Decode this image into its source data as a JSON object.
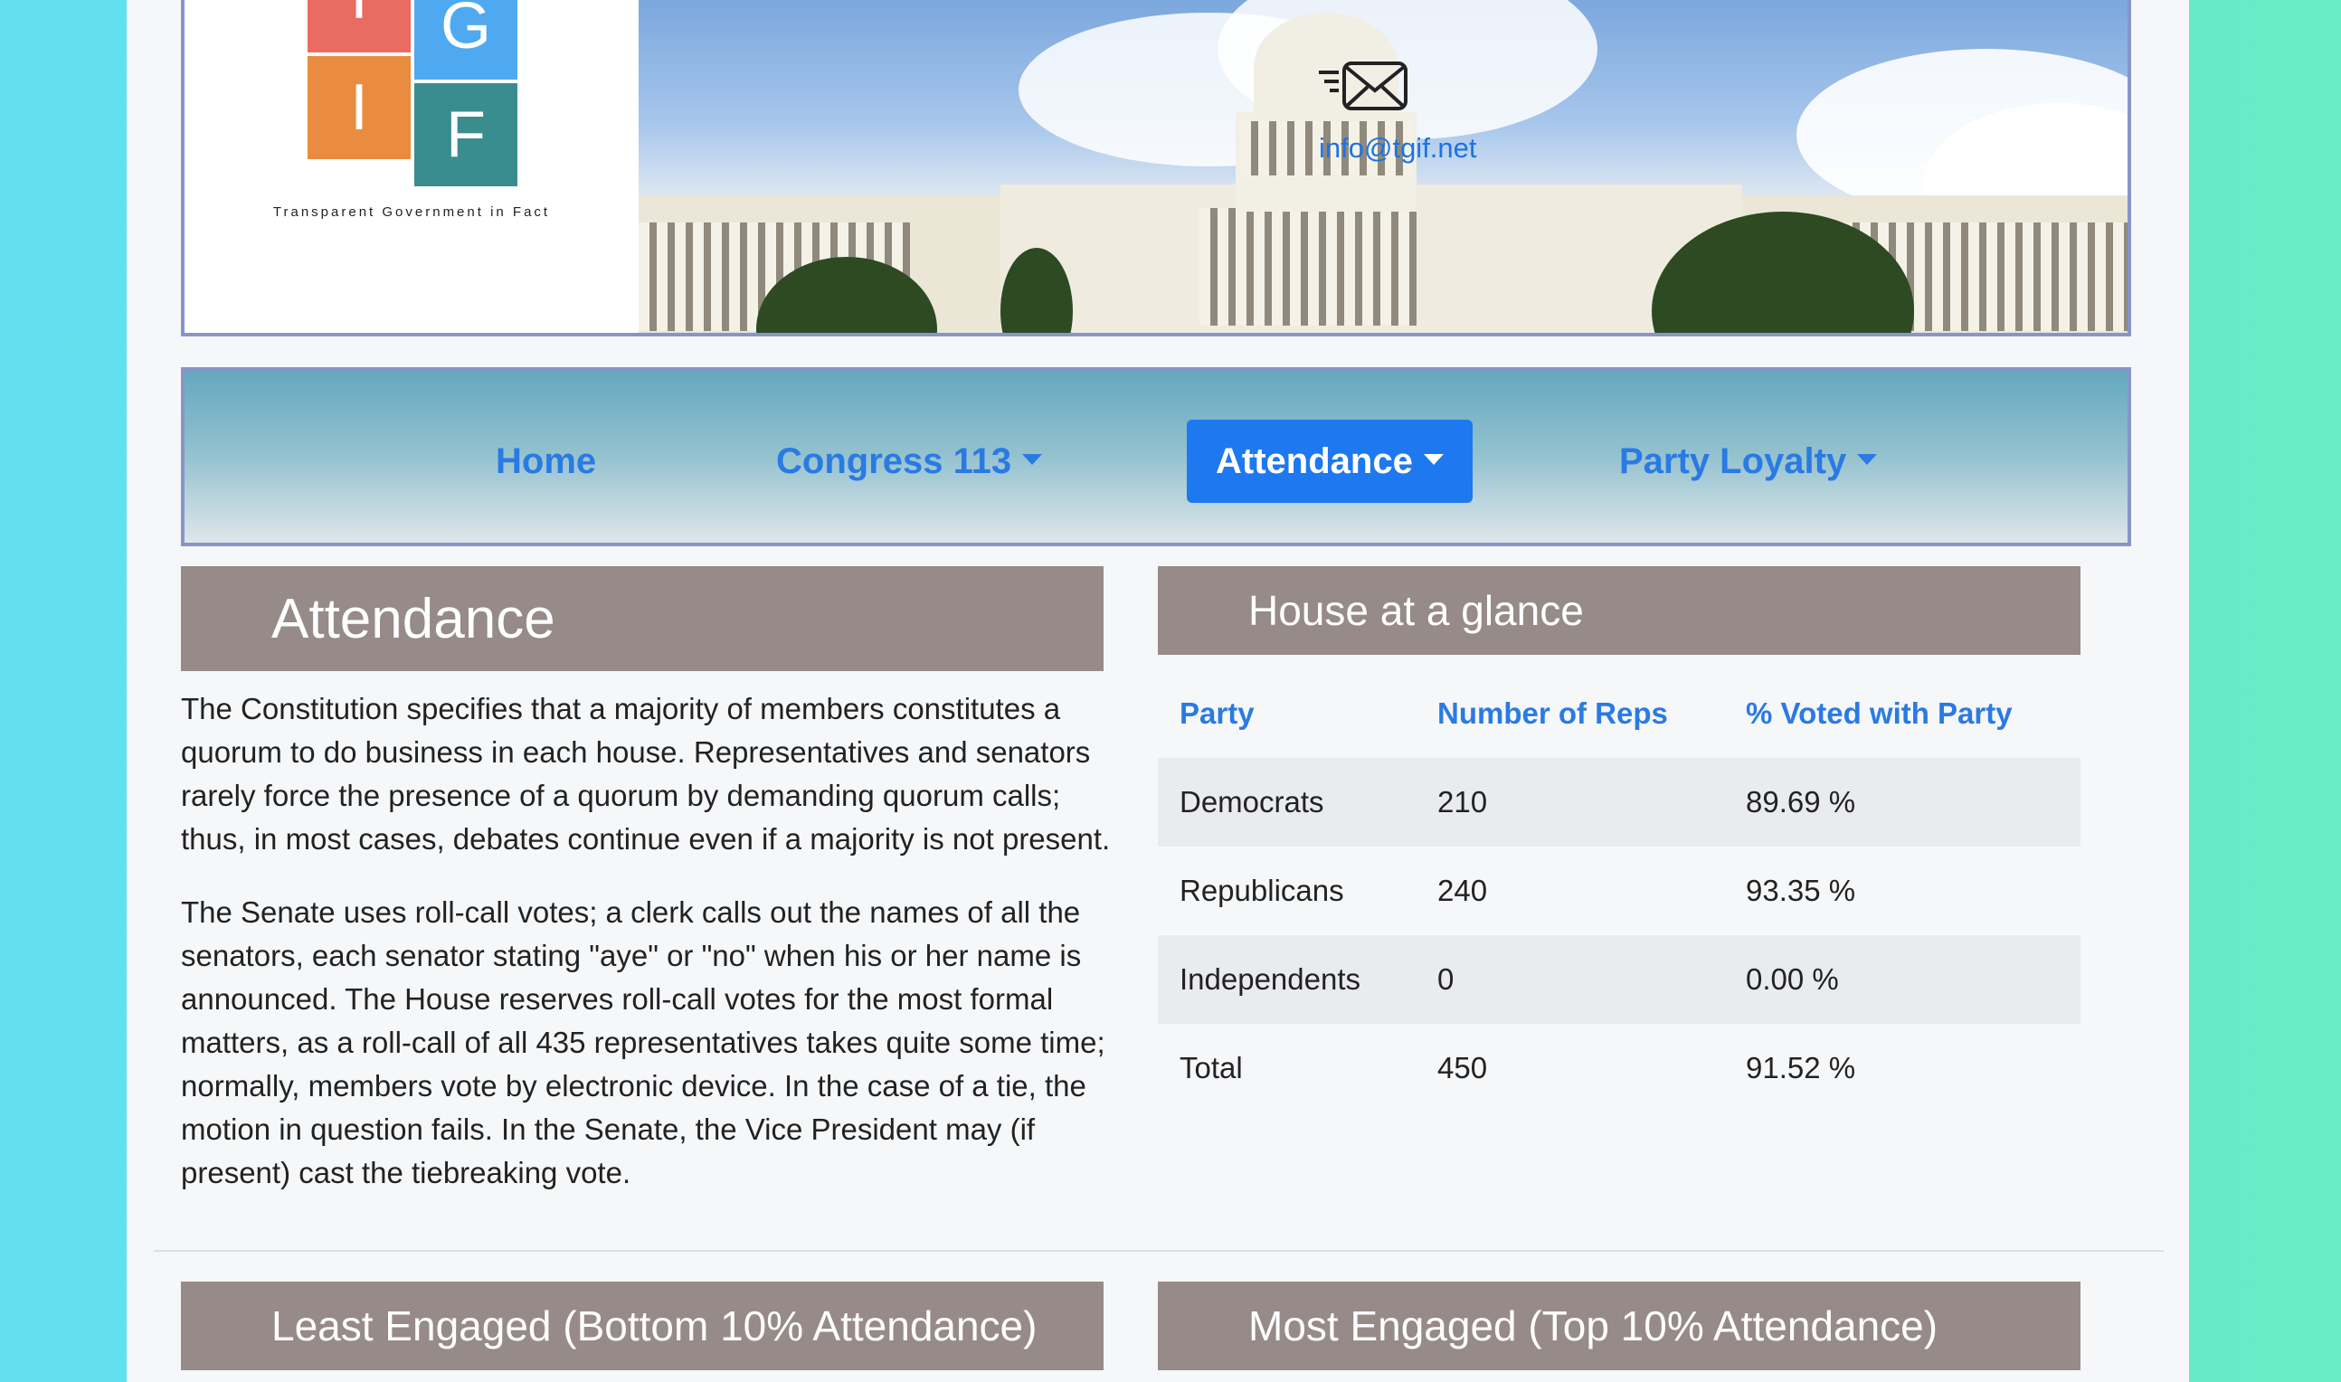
{
  "header": {
    "logo_letters": {
      "t": "T",
      "g": "G",
      "i": "I",
      "f": "F"
    },
    "tagline": "Transparent Government in Fact",
    "email": "info@tgif.net"
  },
  "nav": {
    "home": "Home",
    "congress": "Congress 113",
    "attendance": "Attendance",
    "party_loyalty": "Party Loyalty"
  },
  "attendance": {
    "title": "Attendance",
    "paragraph1": "The Constitution specifies that a majority of members constitutes a quorum to do business in each house. Representatives and senators rarely force the presence of a quorum by demanding quorum calls; thus, in most cases, debates continue even if a majority is not present.",
    "paragraph2": "The Senate uses roll-call votes; a clerk calls out the names of all the senators, each senator stating \"aye\" or \"no\" when his or her name is announced. The House reserves roll-call votes for the most formal matters, as a roll-call of all 435 representatives takes quite some time; normally, members vote by electronic device. In the case of a tie, the motion in question fails. In the Senate, the Vice President may (if present) cast the tiebreaking vote."
  },
  "glance": {
    "title": "House at a glance",
    "columns": [
      "Party",
      "Number of Reps",
      "% Voted with Party"
    ],
    "rows": [
      [
        "Democrats",
        "210",
        "89.69 %"
      ],
      [
        "Republicans",
        "240",
        "93.35 %"
      ],
      [
        "Independents",
        "0",
        "0.00 %"
      ],
      [
        "Total",
        "450",
        "91.52 %"
      ]
    ]
  },
  "least_engaged": {
    "title": "Least Engaged (Bottom 10% Attendance)"
  },
  "most_engaged": {
    "title": "Most Engaged (Top 10% Attendance)"
  },
  "colors": {
    "accent": "#1e78ef",
    "link": "#2a7ae4",
    "section_header": "#968b88"
  }
}
